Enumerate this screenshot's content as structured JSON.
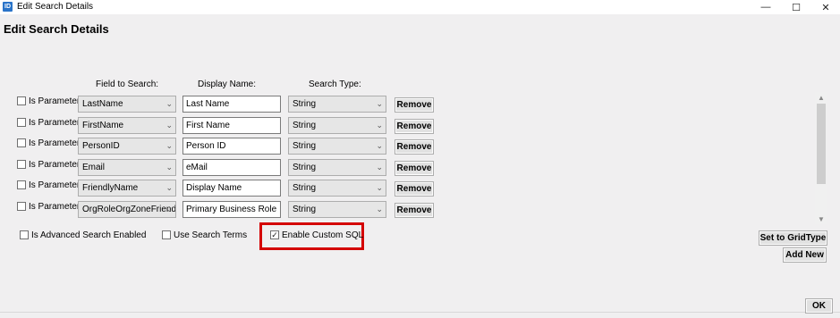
{
  "window": {
    "title": "Edit Search Details",
    "app_icon": "ID",
    "minimize_glyph": "—",
    "maximize_glyph": "☐",
    "close_glyph": "✕"
  },
  "heading": "Edit Search Details",
  "columns": {
    "field": "Field to Search:",
    "display": "Display Name:",
    "type": "Search Type:"
  },
  "rows": [
    {
      "param_label": "Is Parameter",
      "param_checked": false,
      "field": "LastName",
      "display": "Last Name",
      "type": "String",
      "remove": "Remove"
    },
    {
      "param_label": "Is Parameter",
      "param_checked": false,
      "field": "FirstName",
      "display": "First Name",
      "type": "String",
      "remove": "Remove"
    },
    {
      "param_label": "Is Parameter",
      "param_checked": false,
      "field": "PersonID",
      "display": "Person ID",
      "type": "String",
      "remove": "Remove"
    },
    {
      "param_label": "Is Parameter",
      "param_checked": false,
      "field": "Email",
      "display": "eMail",
      "type": "String",
      "remove": "Remove"
    },
    {
      "param_label": "Is Parameter",
      "param_checked": false,
      "field": "FriendlyName",
      "display": "Display Name",
      "type": "String",
      "remove": "Remove"
    },
    {
      "param_label": "Is Parameter",
      "param_checked": false,
      "field": "OrgRoleOrgZoneFriend",
      "display": "Primary Business Role",
      "type": "String",
      "remove": "Remove"
    }
  ],
  "options": {
    "advanced_label": "Is Advanced Search Enabled",
    "advanced_checked": false,
    "search_terms_label": "Use Search Terms",
    "search_terms_checked": false,
    "custom_sql_label": "Enable Custom SQL",
    "custom_sql_checked": true
  },
  "buttons": {
    "set_grid": "Set to GridType",
    "add_new": "Add New",
    "ok": "OK"
  },
  "colors": {
    "highlight": "#d40000",
    "app_icon": "#2a74c9"
  }
}
